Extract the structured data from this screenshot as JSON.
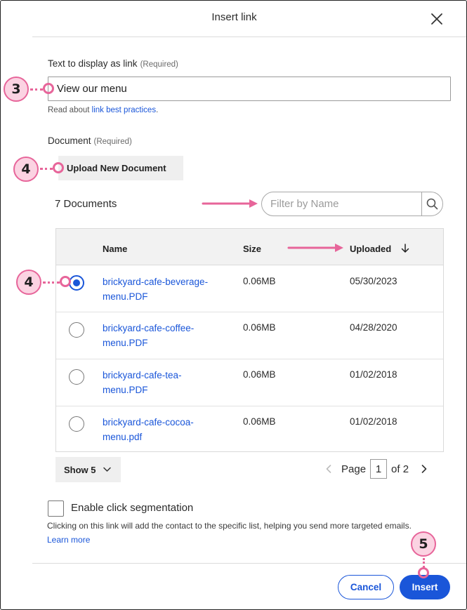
{
  "dialog": {
    "title": "Insert link"
  },
  "link_text": {
    "label": "Text to display as link",
    "required": "(Required)",
    "value": "View our menu",
    "helper_prefix": "Read about ",
    "helper_link": "link best practices",
    "helper_suffix": "."
  },
  "document": {
    "label": "Document",
    "required": "(Required)",
    "upload_label": "Upload New Document",
    "count_label": "7 Documents",
    "filter_placeholder": "Filter by Name"
  },
  "table": {
    "headers": {
      "name": "Name",
      "size": "Size",
      "uploaded": "Uploaded"
    },
    "rows": [
      {
        "name_line1": "brickyard-cafe-beverage-",
        "name_line2": "menu.PDF",
        "size": "0.06MB",
        "uploaded": "05/30/2023",
        "selected": true
      },
      {
        "name_line1": "brickyard-cafe-coffee-",
        "name_line2": "menu.PDF",
        "size": "0.06MB",
        "uploaded": "04/28/2020",
        "selected": false
      },
      {
        "name_line1": "brickyard-cafe-tea-",
        "name_line2": "menu.PDF",
        "size": "0.06MB",
        "uploaded": "01/02/2018",
        "selected": false
      },
      {
        "name_line1": "brickyard-cafe-cocoa-",
        "name_line2": "menu.pdf",
        "size": "0.06MB",
        "uploaded": "01/02/2018",
        "selected": false
      }
    ]
  },
  "pagination": {
    "show_label": "Show 5",
    "page_label": "Page",
    "current_page": "1",
    "of_label": "of 2"
  },
  "segmentation": {
    "label": "Enable click segmentation",
    "checked": false,
    "description": "Clicking on this link will add the contact to the specific list, helping you send more targeted emails.",
    "learn_more": "Learn more"
  },
  "footer": {
    "cancel_label": "Cancel",
    "insert_label": "Insert"
  },
  "callouts": {
    "link_text_step": "3",
    "upload_step": "4",
    "select_step": "4",
    "insert_step": "5"
  },
  "colors": {
    "accent_blue": "#1a56d9",
    "callout_pink": "#e7659a",
    "callout_fill": "#fbd3e2"
  },
  "icons": {
    "close": "close-icon",
    "search": "search-icon",
    "sort_down": "arrow-down-icon",
    "chevron": "chevron-down-icon",
    "prev": "chevron-left-icon",
    "next": "chevron-right-icon"
  }
}
